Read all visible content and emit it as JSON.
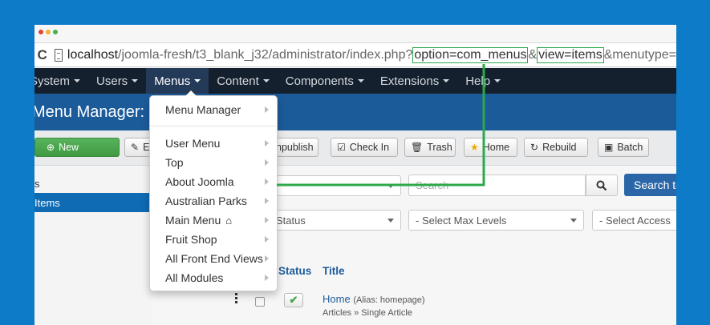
{
  "browser": {
    "url_host": "localhost",
    "url_path": "/joomla-fresh/t3_blank_j32/administrator/index.php?",
    "url_param_option": "option=com_menus",
    "url_sep": "&",
    "url_param_view": "view=items",
    "url_rest": "&menutype="
  },
  "navbar": {
    "items": [
      {
        "label": "System"
      },
      {
        "label": "Users"
      },
      {
        "label": "Menus"
      },
      {
        "label": "Content"
      },
      {
        "label": "Components"
      },
      {
        "label": "Extensions"
      },
      {
        "label": "Help"
      }
    ]
  },
  "header": {
    "title": "Menu Manager: "
  },
  "toolbar": {
    "new": "New",
    "edit": "E",
    "unpublish": "npublish",
    "checkin": "Check In",
    "trash": "Trash",
    "home": "Home",
    "rebuild": "Rebuild",
    "batch": "Batch"
  },
  "sidebar": {
    "items": [
      {
        "label": "s"
      },
      {
        "label": " Items"
      }
    ]
  },
  "filters": {
    "menu_select": "",
    "search_placeholder": "Search",
    "search_button": "Search to",
    "status_select": "Status",
    "max_levels_select": "- Select Max Levels",
    "access_select": "- Select Access"
  },
  "table": {
    "headers": {
      "status": "Status",
      "title": "Title"
    },
    "rows": [
      {
        "title": "Home",
        "alias": "(Alias: homepage)",
        "type": "Articles » Single Article"
      }
    ]
  },
  "dropdown": {
    "items": [
      {
        "label": "Menu Manager"
      },
      {
        "label": "User Menu"
      },
      {
        "label": "Top"
      },
      {
        "label": "About Joomla"
      },
      {
        "label": "Australian Parks"
      },
      {
        "label": "Main Menu"
      },
      {
        "label": "Fruit Shop"
      },
      {
        "label": "All Front End Views"
      },
      {
        "label": "All Modules"
      }
    ]
  },
  "colors": {
    "background": "#0d7bc8",
    "navbar": "#15202e",
    "header": "#1c5b9a",
    "annotation": "#2da84a",
    "new_button": "#46a546"
  }
}
